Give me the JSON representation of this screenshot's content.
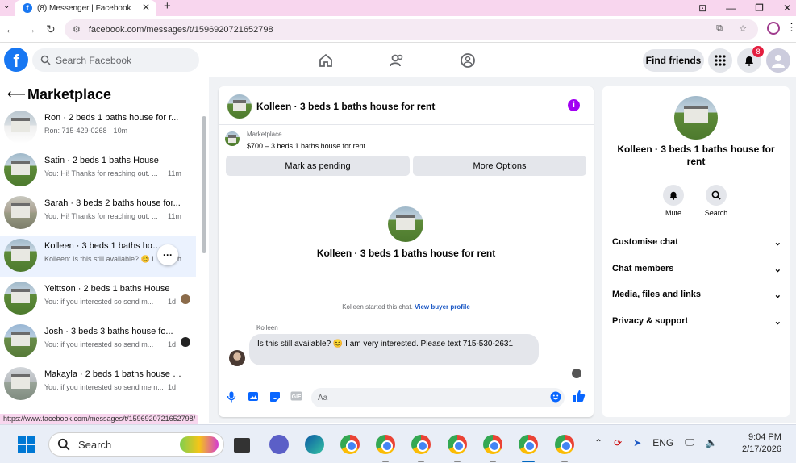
{
  "browser": {
    "tab_title": "(8) Messenger | Facebook",
    "url": "facebook.com/messages/t/1596920721652798",
    "status_url": "https://www.facebook.com/messages/t/1596920721652798/"
  },
  "header": {
    "search_placeholder": "Search Facebook",
    "find_friends": "Find friends",
    "notification_count": "8"
  },
  "left": {
    "title": "Marketplace",
    "conversations": [
      {
        "name": "Ron · 2 beds 1 baths house for r...",
        "preview": "Ron: 715-429-0268 · 10m",
        "time": ""
      },
      {
        "name": "Satin · 2 beds 1 baths House",
        "preview": "You: Hi! Thanks for reaching out. ...",
        "time": "11m"
      },
      {
        "name": "Sarah · 3 beds 2 baths house for...",
        "preview": "You: Hi! Thanks for reaching out. ...",
        "time": "11m"
      },
      {
        "name": "Kolleen · 3 beds 1 baths hous",
        "preview": "Kolleen: Is this still available? 😊 I",
        "time": "h"
      },
      {
        "name": "Yeittson · 2 beds 1 baths House",
        "preview": "You: if you interested so send m...",
        "time": "1d"
      },
      {
        "name": "Josh · 3 beds 3 baths house fo...",
        "preview": "You: if you interested so send m...",
        "time": "1d"
      },
      {
        "name": "Makayla · 2 beds 1 baths house f...",
        "preview": "You: if you interested so send me n...",
        "time": "1d"
      }
    ]
  },
  "chat": {
    "title": "Kolleen · 3 beds 1 baths house for rent",
    "source": "Marketplace",
    "listing": "$700 – 3 beds 1 baths house for rent",
    "mark_pending": "Mark as pending",
    "more_options": "More Options",
    "started_text": "Kolleen started this chat.",
    "view_profile": "View buyer profile",
    "sender": "Kolleen",
    "message": "Is this still available? 😊 I am very interested. Please text 715-530-2631",
    "input_placeholder": "Aa"
  },
  "right": {
    "title": "Kolleen · 3 beds 1 baths house for rent",
    "mute": "Mute",
    "search": "Search",
    "rows": [
      "Customise chat",
      "Chat members",
      "Media, files and links",
      "Privacy & support"
    ]
  },
  "taskbar": {
    "search": "Search",
    "lang": "ENG",
    "time": "9:04 PM",
    "date": "2/17/2026"
  }
}
